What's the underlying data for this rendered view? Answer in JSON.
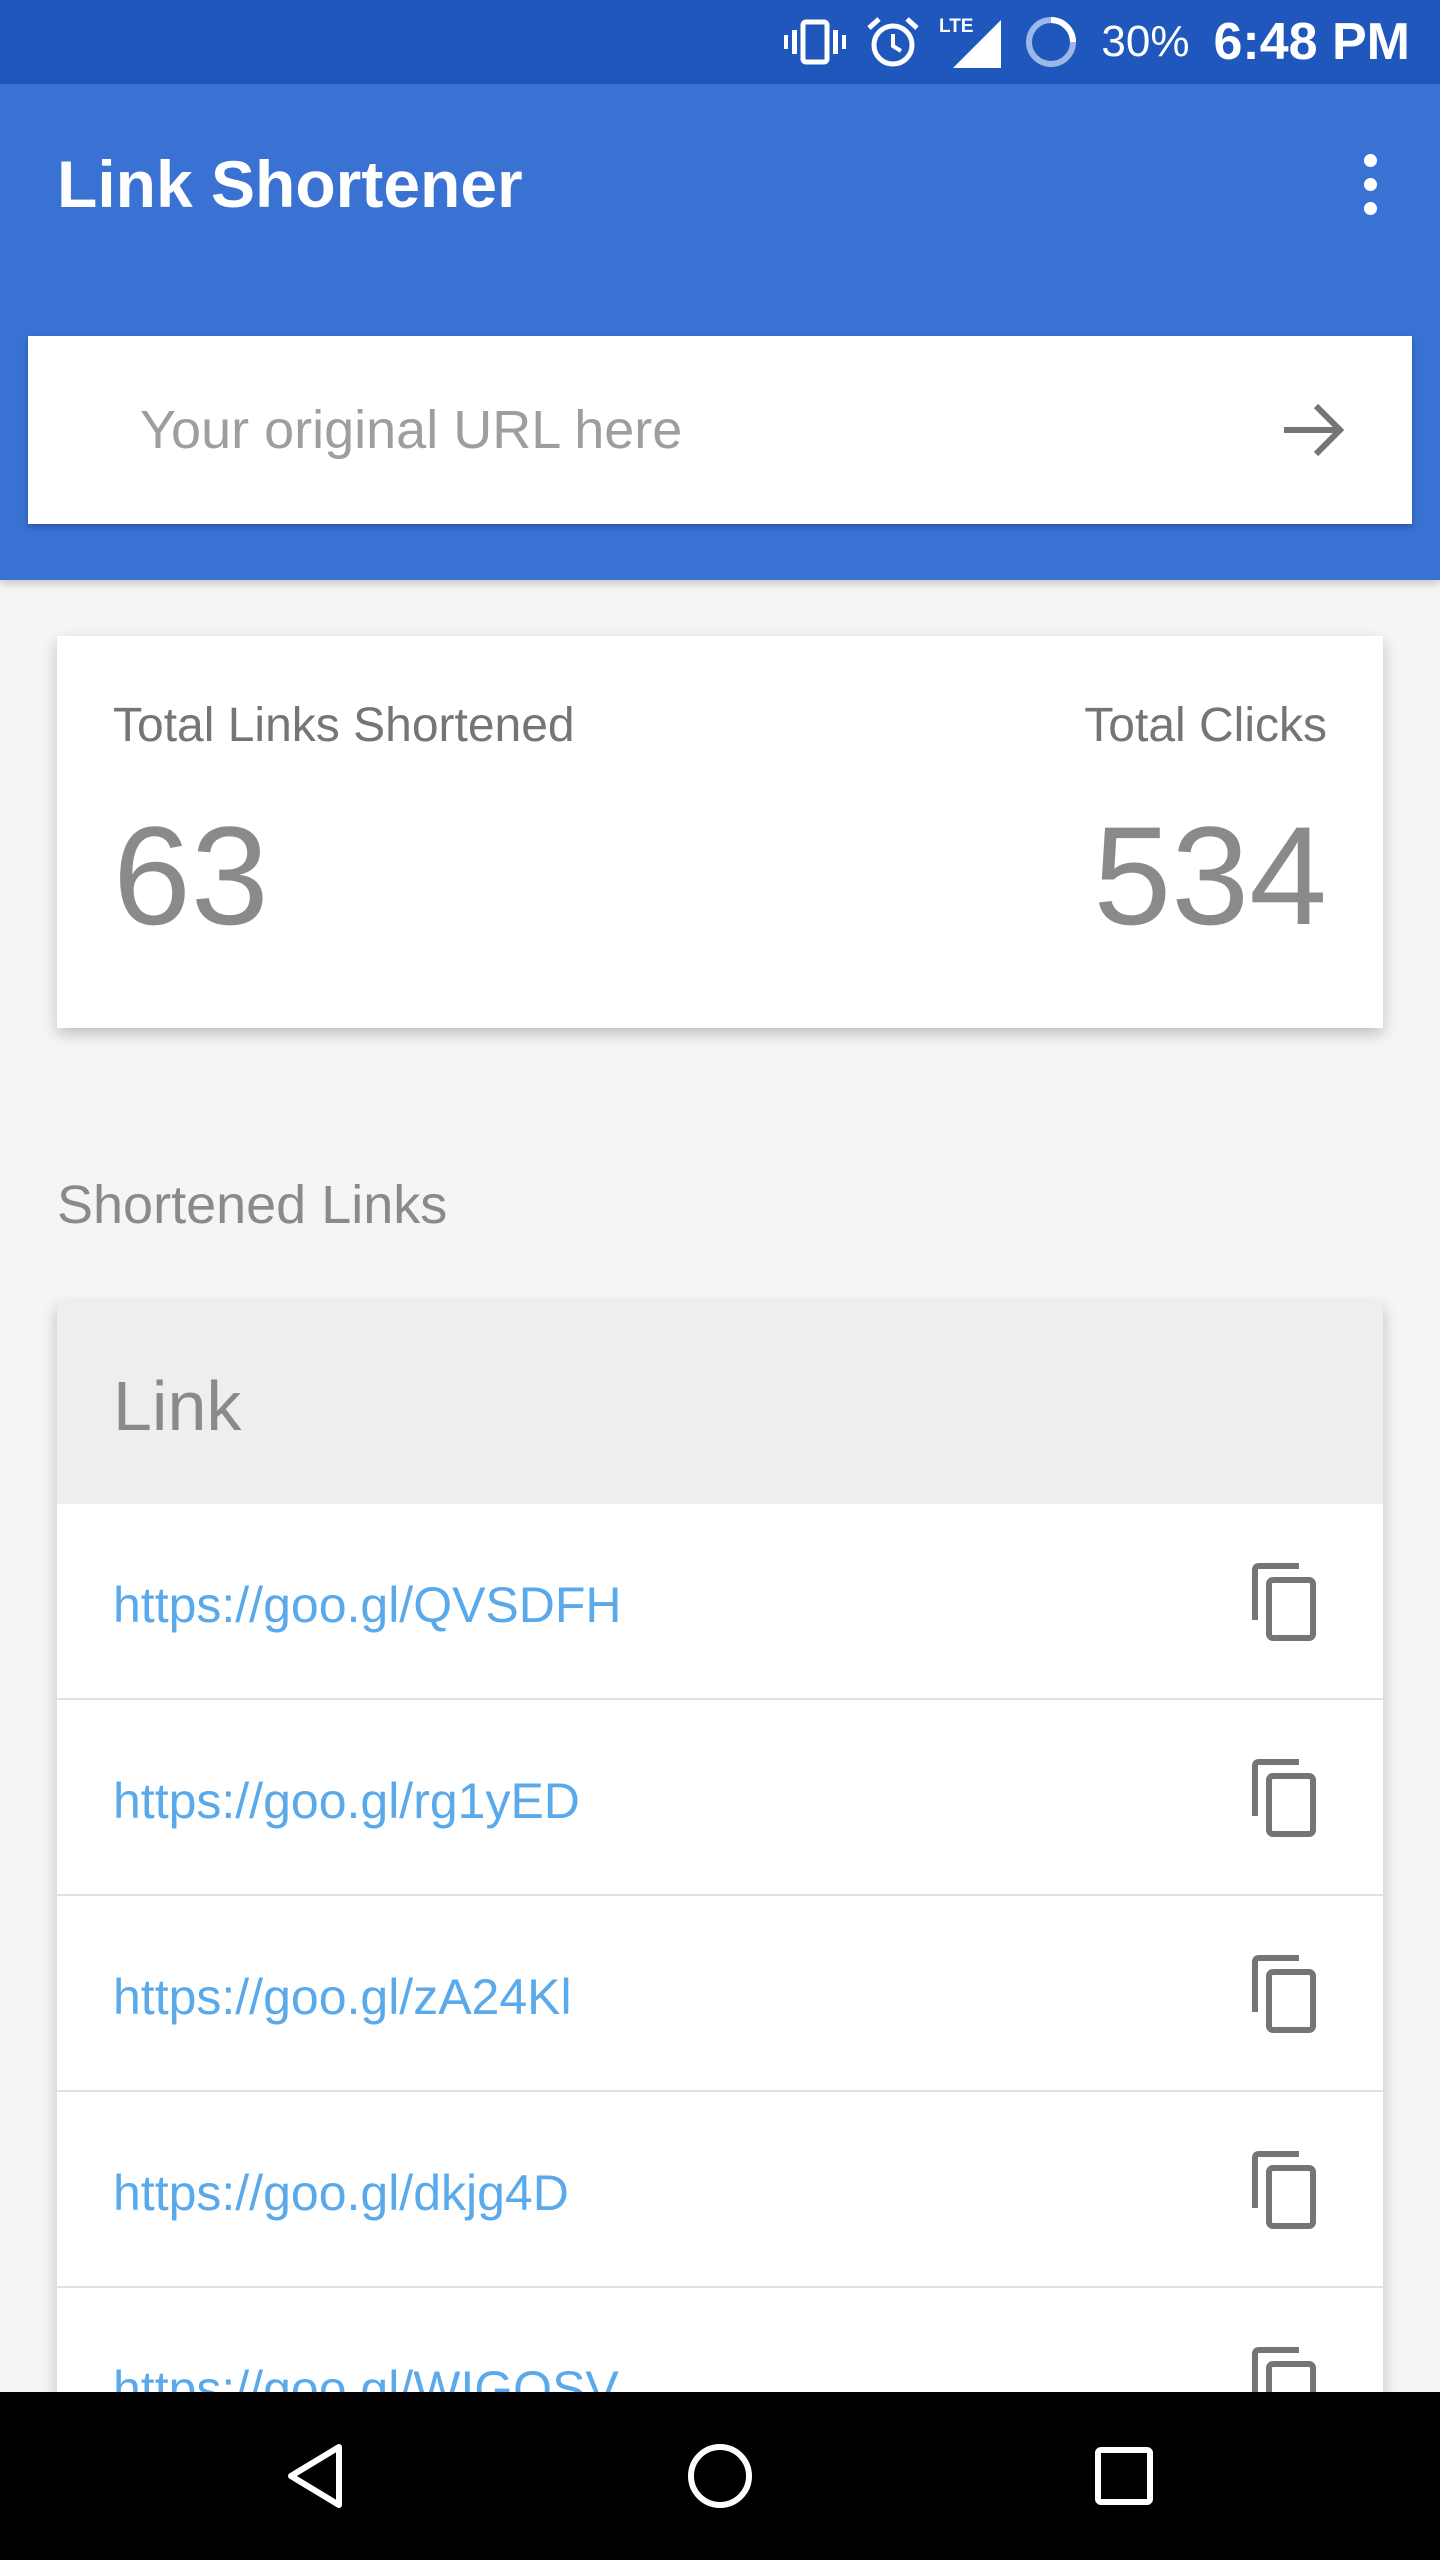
{
  "status_bar": {
    "network": "LTE",
    "battery": "30%",
    "time": "6:48 PM",
    "icons": [
      "vibrate-icon",
      "alarm-icon",
      "lte-signal-icon",
      "battery-icon"
    ]
  },
  "app_bar": {
    "title": "Link Shortener",
    "overflow_icon": "more-vert-icon"
  },
  "url_input": {
    "placeholder": "Your original URL here",
    "value": "",
    "submit_icon": "arrow-forward-icon"
  },
  "stats": {
    "links_label": "Total Links Shortened",
    "links_value": "63",
    "clicks_label": "Total Clicks",
    "clicks_value": "534"
  },
  "links_section": {
    "heading": "Shortened Links",
    "column_header": "Link",
    "copy_icon": "copy-icon",
    "rows": [
      {
        "url": "https://goo.gl/QVSDFH"
      },
      {
        "url": "https://goo.gl/rg1yED"
      },
      {
        "url": "https://goo.gl/zA24Kl"
      },
      {
        "url": "https://goo.gl/dkjg4D"
      },
      {
        "url": "https://goo.gl/WIGOSV"
      }
    ]
  },
  "nav_bar": {
    "icons": [
      "back-icon",
      "home-icon",
      "recents-icon"
    ]
  },
  "colors": {
    "status_bar": "#1f57bd",
    "app_bar": "#3a72d4",
    "link_text": "#5aa9ea",
    "background": "#f5f5f5"
  }
}
